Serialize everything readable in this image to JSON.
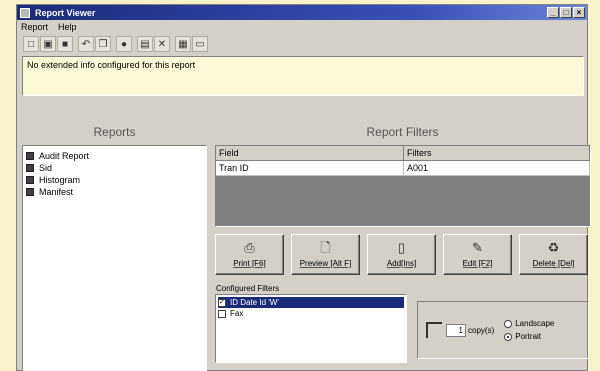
{
  "window": {
    "title": "Report Viewer"
  },
  "menu": [
    "Report",
    "Help"
  ],
  "toolbar": {
    "icons": [
      "new-icon",
      "open-icon",
      "save-icon",
      "undo-icon",
      "copy-icon",
      "refresh-icon",
      "print-icon",
      "delete-icon",
      "export-icon",
      "properties-icon"
    ]
  },
  "info": {
    "text": "No extended info configured for this report"
  },
  "reports": {
    "header": "Reports",
    "items": [
      "Audit Report",
      "Sid",
      "Histogram",
      "Manifest"
    ]
  },
  "filters": {
    "header": "Report Filters",
    "columns": [
      "Field",
      "Filters"
    ],
    "rows": [
      {
        "field": "Tran ID",
        "filter": "A001"
      }
    ]
  },
  "buttons": [
    {
      "label": "Print [F6]",
      "icon": "print-icon"
    },
    {
      "label": "Preview [Alt F]",
      "icon": "preview-icon"
    },
    {
      "label": "Add[Ins]",
      "icon": "add-icon"
    },
    {
      "label": "Edit [F2]",
      "icon": "edit-icon"
    },
    {
      "label": "Delete [Del]",
      "icon": "delete-icon"
    }
  ],
  "configured": {
    "label": "Configured Filters",
    "items": [
      {
        "text": "ID Date Id 'W'",
        "checked": true,
        "selected": true
      },
      {
        "text": "Fax",
        "checked": false,
        "selected": false
      }
    ]
  },
  "print_options": {
    "copies": "1",
    "copies_label": "copy(s)",
    "orientation": [
      "Landscape",
      "Portrait"
    ],
    "selected": "Portrait"
  }
}
